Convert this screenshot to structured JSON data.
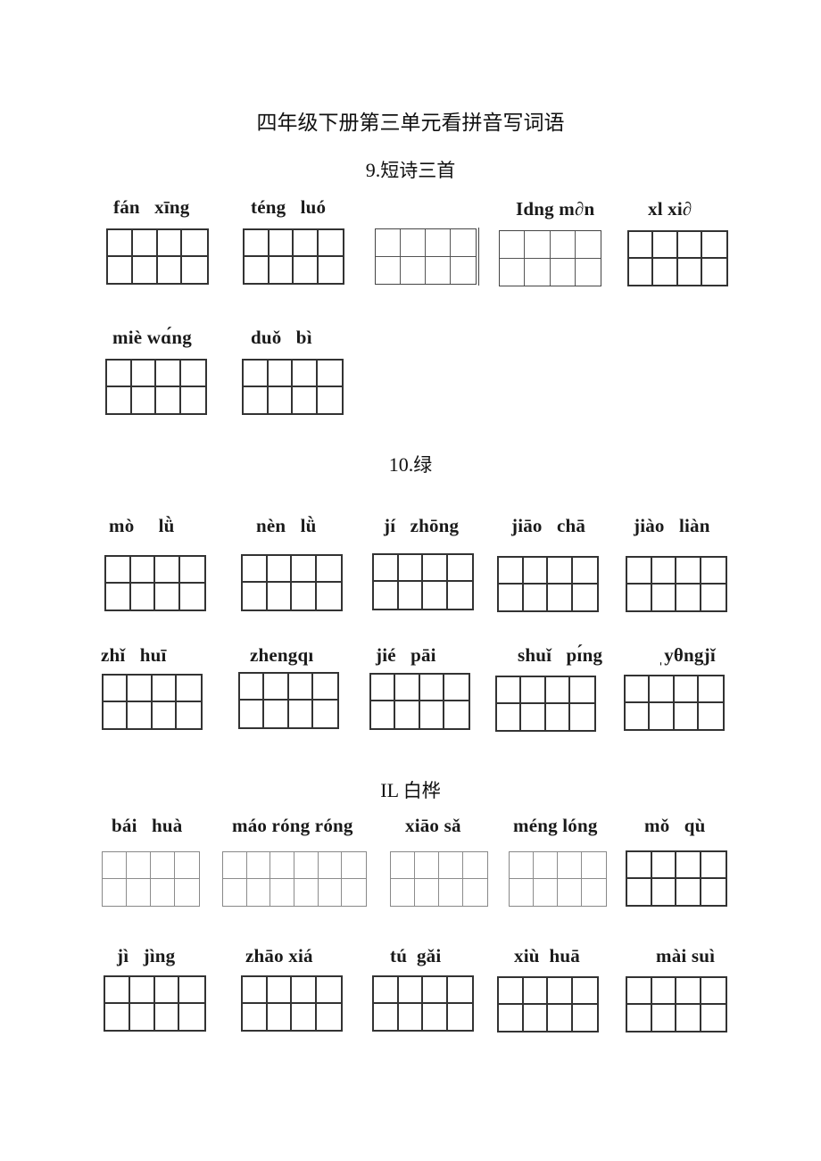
{
  "page": {
    "title": "四年级下册第三单元看拼音写词语"
  },
  "sections": [
    {
      "number": "9.",
      "name": "短诗三首",
      "rows": [
        [
          {
            "pinyin": "fán   xīng",
            "chars": 4
          },
          {
            "pinyin": "téng   luó",
            "chars": 4
          },
          {
            "pinyin": "",
            "chars": 4
          },
          {
            "pinyin": "Idng m∂n",
            "chars": 4
          },
          {
            "pinyin": "xl xi∂",
            "chars": 4
          }
        ],
        [
          {
            "pinyin": "miè wɑ́ng",
            "chars": 4
          },
          {
            "pinyin": "duǒ   bì",
            "chars": 4
          }
        ]
      ]
    },
    {
      "number": "10.",
      "name": "绿",
      "rows": [
        [
          {
            "pinyin": "mò     lǜ",
            "chars": 4
          },
          {
            "pinyin": "nèn   lǜ",
            "chars": 4
          },
          {
            "pinyin": "jí   zhōng",
            "chars": 4
          },
          {
            "pinyin": "jiāo   chā",
            "chars": 4
          },
          {
            "pinyin": "jiào   liàn",
            "chars": 4
          }
        ],
        [
          {
            "pinyin": "zhǐ   huī",
            "chars": 4
          },
          {
            "pinyin": "zhengqı",
            "chars": 4
          },
          {
            "pinyin": "jié   pāi",
            "chars": 4
          },
          {
            "pinyin": "shuǐ   pɪ́ng",
            "chars": 4
          },
          {
            "pinyin": "ˌyθngjǐ",
            "chars": 4
          }
        ]
      ]
    },
    {
      "number": "IL ",
      "name": "白桦",
      "rows": [
        [
          {
            "pinyin": "bái   huà",
            "chars": 4
          },
          {
            "pinyin": "máo róng róng",
            "chars": 6
          },
          {
            "pinyin": "xiāo sǎ",
            "chars": 4
          },
          {
            "pinyin": "méng lóng",
            "chars": 4
          },
          {
            "pinyin": "mǒ   qù",
            "chars": 4
          }
        ],
        [
          {
            "pinyin": "jì   jìng",
            "chars": 4
          },
          {
            "pinyin": "zhāo xiá",
            "chars": 4
          },
          {
            "pinyin": "tú  gǎi",
            "chars": 4
          },
          {
            "pinyin": "xiù  huā",
            "chars": 4
          },
          {
            "pinyin": "mài suì",
            "chars": 4
          }
        ]
      ]
    }
  ]
}
